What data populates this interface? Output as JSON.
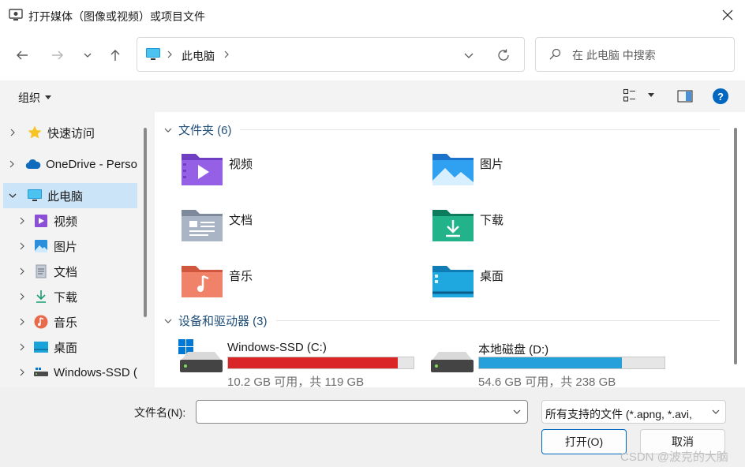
{
  "window": {
    "title": "打开媒体（图像或视频）或项目文件"
  },
  "address": {
    "crumb": "此电脑"
  },
  "search": {
    "placeholder": "在 此电脑 中搜索"
  },
  "commandbar": {
    "organize": "组织"
  },
  "sidebar": {
    "items": [
      {
        "label": "快速访问",
        "icon": "star-icon"
      },
      {
        "label": "OneDrive - Perso",
        "icon": "cloud-icon"
      },
      {
        "label": "此电脑",
        "icon": "computer-icon"
      },
      {
        "label": "视频",
        "icon": "video-icon"
      },
      {
        "label": "图片",
        "icon": "picture-icon"
      },
      {
        "label": "文档",
        "icon": "document-icon"
      },
      {
        "label": "下载",
        "icon": "download-icon"
      },
      {
        "label": "音乐",
        "icon": "music-icon"
      },
      {
        "label": "桌面",
        "icon": "desktop-icon"
      },
      {
        "label": "Windows-SSD (",
        "icon": "drive-icon"
      }
    ]
  },
  "content": {
    "folders_header": "文件夹 (6)",
    "folders": [
      {
        "name": "视频",
        "icon": "video-folder-icon"
      },
      {
        "name": "图片",
        "icon": "pictures-folder-icon"
      },
      {
        "name": "文档",
        "icon": "documents-folder-icon"
      },
      {
        "name": "下载",
        "icon": "downloads-folder-icon"
      },
      {
        "name": "音乐",
        "icon": "music-folder-icon"
      },
      {
        "name": "桌面",
        "icon": "desktop-folder-icon"
      }
    ],
    "drives_header": "设备和驱动器 (3)",
    "drives": [
      {
        "name": "Windows-SSD (C:)",
        "size": "10.2 GB 可用，共 119 GB",
        "used_fraction": 0.914,
        "bar_color": "#da2626"
      },
      {
        "name": "本地磁盘 (D:)",
        "size": "54.6 GB 可用，共 238 GB",
        "used_fraction": 0.771,
        "bar_color": "#26a0da"
      }
    ]
  },
  "footer": {
    "filename_label": "文件名(N):",
    "filename_value": "",
    "filter": "所有支持的文件 (*.apng, *.avi,",
    "open_button": "打开(O)",
    "cancel_button": "取消"
  },
  "watermark": "CSDN @波克的大脑",
  "colors": {
    "accent": "#0067c0",
    "selected": "#cce4f7",
    "group_header": "#1f4e79"
  }
}
